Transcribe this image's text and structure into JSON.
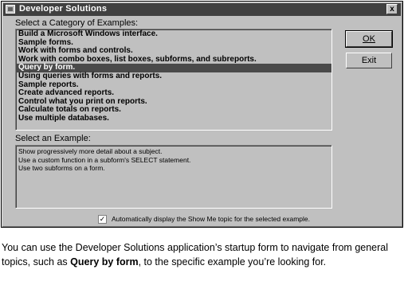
{
  "window": {
    "title": "Developer Solutions",
    "close_glyph": "x"
  },
  "categories": {
    "heading": "Select a Category of Examples:",
    "items": [
      "Build a Microsoft Windows interface.",
      "Sample forms.",
      "Work with forms and controls.",
      "Work with combo boxes, list boxes, subforms, and subreports.",
      "Query by form.",
      "Using queries with forms and reports.",
      "Sample reports.",
      "Create advanced reports.",
      "Control what you print on reports.",
      "Calculate totals on reports.",
      "Use multiple databases."
    ],
    "selected_index": 4
  },
  "examples": {
    "heading": "Select an Example:",
    "items": [
      "Show progressively more detail about a subject.",
      "Use a custom function in a subform's SELECT statement.",
      "Use two subforms on a form."
    ]
  },
  "buttons": {
    "ok": "OK",
    "exit": "Exit"
  },
  "show_me": {
    "checked": true,
    "check_glyph": "✓",
    "label": "Automatically display the Show Me topic for the selected example."
  },
  "caption": {
    "part1": "You can use the Developer Solutions application’s startup form to navigate from general topics, such as ",
    "bold": "Query by form",
    "part2": ", to the specific example you’re looking for."
  }
}
